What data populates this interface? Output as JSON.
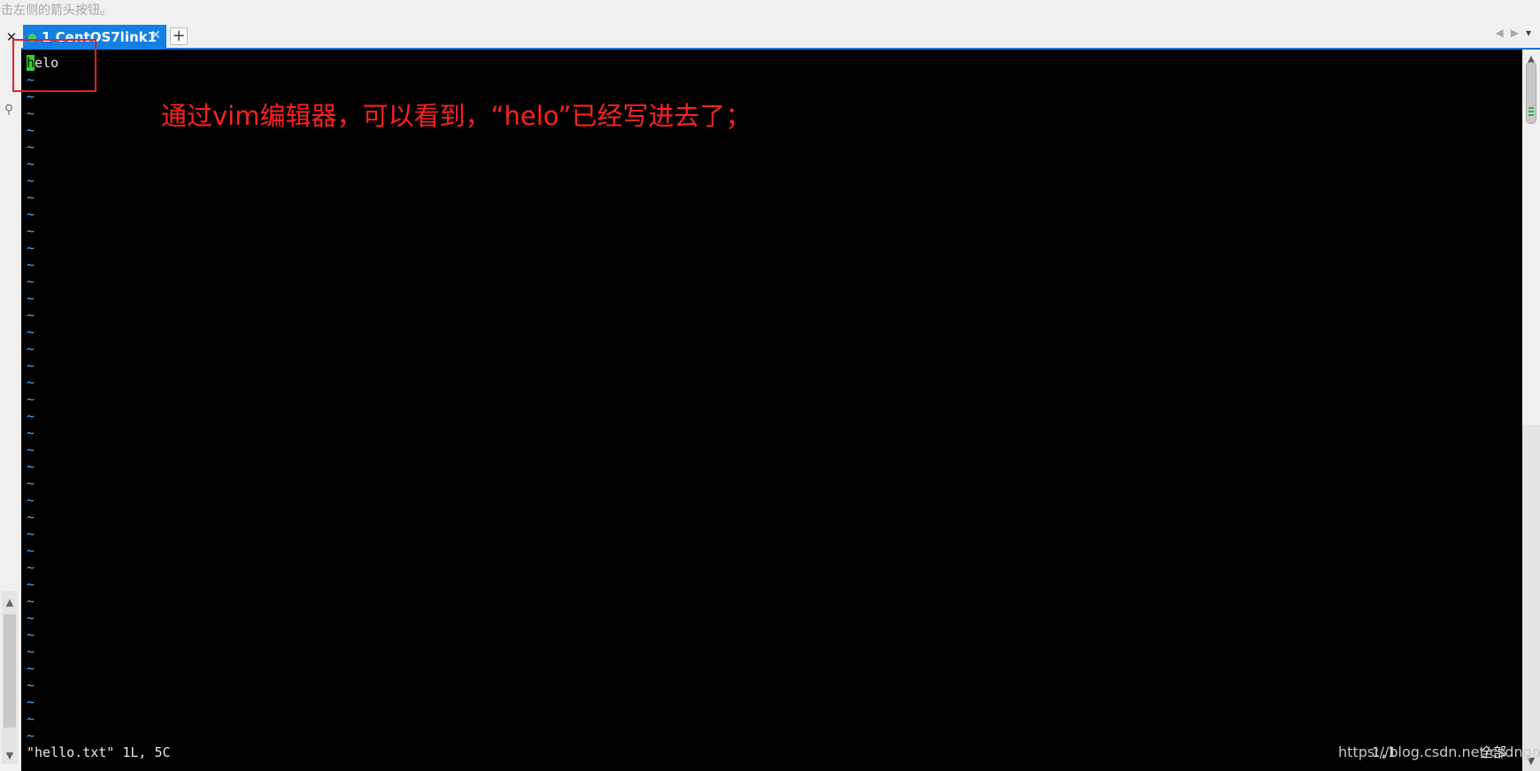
{
  "window": {
    "hint_text": "击左侧的箭头按钮。",
    "close_icon": "close-icon",
    "search_icon": "search-icon"
  },
  "tabs": [
    {
      "label": "1 CentOS7link1",
      "active": true,
      "status_color": "#3bd15c"
    }
  ],
  "tabbar": {
    "add_label": "+",
    "prev": "◀",
    "next": "▶",
    "menu": "▾"
  },
  "terminal": {
    "cursor_char": "h",
    "first_line_rest": "elo",
    "tilde": "~",
    "tilde_count": 40,
    "status_line": "\"hello.txt\" 1L, 5C",
    "ruler": "1,1",
    "position": "全部"
  },
  "annotation": {
    "text": "通过vim编辑器，可以看到，“helo”已经写进去了；",
    "color": "#ff2020"
  },
  "watermark": "https://blog.csdn.net/csdngoal"
}
